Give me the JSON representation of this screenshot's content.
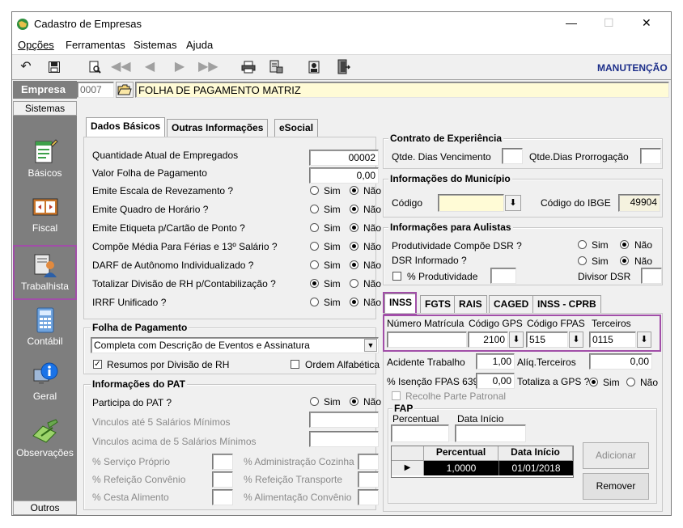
{
  "window": {
    "title": "Cadastro de Empresas",
    "minimize": "—",
    "maximize": "☐",
    "close": "✕"
  },
  "menu": [
    "Opções",
    "Ferramentas",
    "Sistemas",
    "Ajuda"
  ],
  "toolbar": {
    "mode": "MANUTENÇÃO"
  },
  "empresa": {
    "label": "Empresa",
    "code": "0007",
    "name": "FOLHA DE PAGAMENTO MATRIZ"
  },
  "sidebar": {
    "top": "Sistemas",
    "bottom": "Outros",
    "items": [
      "Básicos",
      "Fiscal",
      "Trabalhista",
      "Contábil",
      "Geral",
      "Observações"
    ]
  },
  "tabs": [
    "Dados Básicos",
    "Outras Informações",
    "eSocial"
  ],
  "basic": {
    "qtd_empregados_label": "Quantidade Atual de Empregados",
    "qtd_empregados": "00002",
    "valor_folha_label": "Valor Folha de Pagamento",
    "valor_folha": "0,00",
    "sim": "Sim",
    "nao": "Não",
    "rows": [
      {
        "label": "Emite Escala de Revezamento ?",
        "value": "Não"
      },
      {
        "label": "Emite Quadro de Horário ?",
        "value": "Não"
      },
      {
        "label": "Emite Etiqueta p/Cartão de Ponto ?",
        "value": "Não"
      },
      {
        "label": "Compõe Média Para Férias e 13º Salário ?",
        "value": "Não"
      },
      {
        "label": "DARF de Autônomo Individualizado ?",
        "value": "Não"
      },
      {
        "label": "Totalizar Divisão de RH p/Contabilização ?",
        "value": "Sim"
      },
      {
        "label": "IRRF Unificado ?",
        "value": "Não"
      }
    ]
  },
  "folha": {
    "title": "Folha de Pagamento",
    "select": "Completa com Descrição de Eventos e Assinatura",
    "resumos": "Resumos por Divisão de RH",
    "ordem": "Ordem Alfabética"
  },
  "pat": {
    "title": "Informações do PAT",
    "participa": "Participa do PAT ?",
    "vinc5": "Vinculos até 5 Salários Mínimos",
    "vinc5plus": "Vinculos acima de 5 Salários Mínimos",
    "servico": "% Serviço Próprio",
    "adm_cozinha": "% Administração Cozinha",
    "ref_convenio": "% Refeição Convênio",
    "ref_transporte": "% Refeição Transporte",
    "cesta": "% Cesta Alimento",
    "alim_convenio": "% Alimentação Convênio"
  },
  "contrato": {
    "title": "Contrato de Experiência",
    "dias_venc": "Qtde. Dias Vencimento",
    "dias_prorr": "Qtde.Dias Prorrogação"
  },
  "municipio": {
    "title": "Informações do Município",
    "codigo": "Código",
    "ibge_label": "Código do IBGE",
    "ibge": "49904"
  },
  "aulistas": {
    "title": "Informações para Aulistas",
    "prod_dsr": "Produtividade Compõe DSR ?",
    "dsr_inf": "DSR Informado ?",
    "pct_prod": "% Produtividade",
    "divisor": "Divisor DSR"
  },
  "inss_tabs": [
    "INSS",
    "FGTS",
    "RAIS",
    "CAGED",
    "INSS - CPRB"
  ],
  "inss": {
    "matricula_label": "Número Matrícula",
    "gps_label": "Código GPS",
    "gps": "2100",
    "fpas_label": "Código FPAS",
    "fpas": "515",
    "terceiros_label": "Terceiros",
    "terceiros": "0115",
    "acidente_label": "Acidente Trabalho",
    "acidente": "1,00",
    "aliq_label": "Alíq.Terceiros",
    "aliq": "0,00",
    "isencao_label": "% Isenção FPAS 639",
    "isencao": "0,00",
    "totaliza_label": "Totaliza a GPS ?",
    "recolhe": "Recolhe Parte Patronal"
  },
  "fap": {
    "title": "FAP",
    "percentual_label": "Percentual",
    "data_label": "Data Início",
    "grid_headers": [
      "Percentual",
      "Data Início"
    ],
    "rows": [
      {
        "percentual": "1,0000",
        "data": "01/01/2018"
      }
    ],
    "adicionar": "Adicionar",
    "remover": "Remover"
  }
}
